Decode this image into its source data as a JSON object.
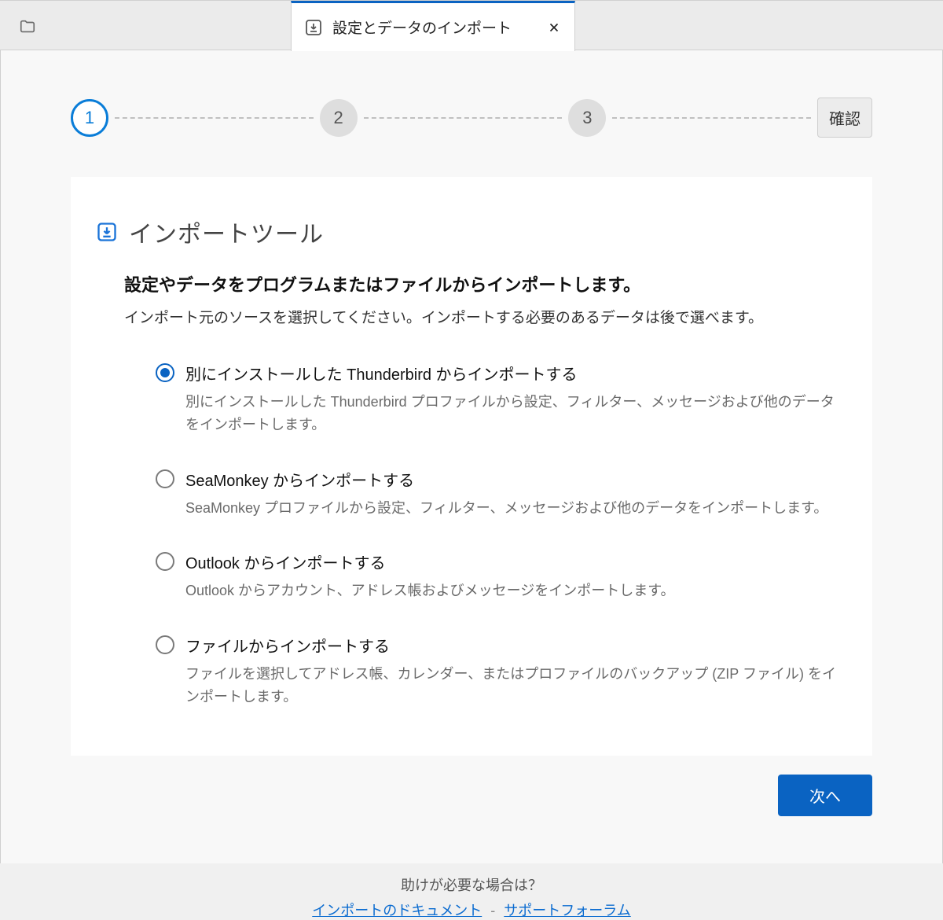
{
  "tab": {
    "title": "設定とデータのインポート"
  },
  "stepper": {
    "step1": "1",
    "step2": "2",
    "step3": "3",
    "confirm": "確認"
  },
  "card": {
    "title": "インポートツール",
    "lead_strong": "設定やデータをプログラムまたはファイルからインポートします。",
    "lead_sub": "インポート元のソースを選択してください。インポートする必要のあるデータは後で選べます。"
  },
  "options": [
    {
      "title": "別にインストールした Thunderbird からインポートする",
      "desc": "別にインストールした Thunderbird プロファイルから設定、フィルター、メッセージおよび他のデータをインポートします。",
      "selected": true
    },
    {
      "title": "SeaMonkey からインポートする",
      "desc": "SeaMonkey プロファイルから設定、フィルター、メッセージおよび他のデータをインポートします。",
      "selected": false
    },
    {
      "title": "Outlook からインポートする",
      "desc": "Outlook からアカウント、アドレス帳およびメッセージをインポートします。",
      "selected": false
    },
    {
      "title": "ファイルからインポートする",
      "desc": "ファイルを選択してアドレス帳、カレンダー、またはプロファイルのバックアップ (ZIP ファイル) をインポートします。",
      "selected": false
    }
  ],
  "actions": {
    "next": "次へ"
  },
  "help": {
    "prompt": "助けが必要な場合は？",
    "doc_link": "インポートのドキュメント",
    "separator": "-",
    "forum_link": "サポートフォーラム"
  }
}
